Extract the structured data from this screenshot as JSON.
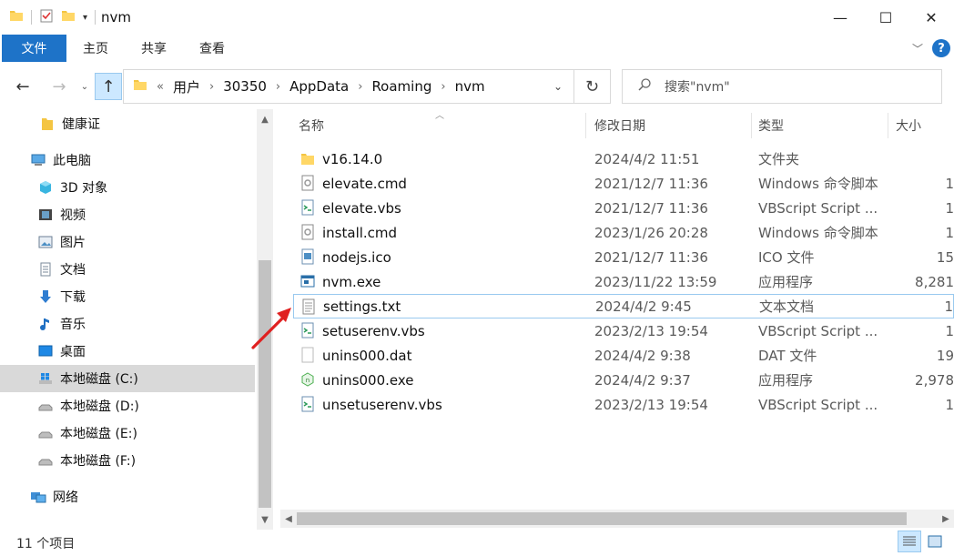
{
  "window": {
    "title": "nvm",
    "minimize": "—",
    "maximize": "☐",
    "close": "✕"
  },
  "ribbon": {
    "file": "文件",
    "home": "主页",
    "share": "共享",
    "view": "查看",
    "help": "?"
  },
  "address": {
    "overflow": "«",
    "crumbs": [
      "用户",
      "30350",
      "AppData",
      "Roaming",
      "nvm"
    ],
    "search_placeholder": "搜索\"nvm\""
  },
  "sidebar": {
    "items": [
      {
        "label": "健康证",
        "icon": "folder-icon"
      },
      {
        "label": "此电脑",
        "icon": "computer-icon"
      },
      {
        "label": "3D 对象",
        "icon": "3d-objects-icon"
      },
      {
        "label": "视频",
        "icon": "video-icon"
      },
      {
        "label": "图片",
        "icon": "pictures-icon"
      },
      {
        "label": "文档",
        "icon": "documents-icon"
      },
      {
        "label": "下载",
        "icon": "download-icon"
      },
      {
        "label": "音乐",
        "icon": "music-icon"
      },
      {
        "label": "桌面",
        "icon": "desktop-icon"
      },
      {
        "label": "本地磁盘 (C:)",
        "icon": "windows-drive-icon",
        "selected": true
      },
      {
        "label": "本地磁盘 (D:)",
        "icon": "drive-icon"
      },
      {
        "label": "本地磁盘 (E:)",
        "icon": "drive-icon"
      },
      {
        "label": "本地磁盘 (F:)",
        "icon": "drive-icon"
      },
      {
        "label": "网络",
        "icon": "network-icon"
      }
    ]
  },
  "columns": {
    "name": "名称",
    "date": "修改日期",
    "type": "类型",
    "size": "大小"
  },
  "files": [
    {
      "name": "v16.14.0",
      "date": "2024/4/2 11:51",
      "type": "文件夹",
      "size": "",
      "icon": "folder-icon"
    },
    {
      "name": "elevate.cmd",
      "date": "2021/12/7 11:36",
      "type": "Windows 命令脚本",
      "size": "1",
      "icon": "cmd-icon"
    },
    {
      "name": "elevate.vbs",
      "date": "2021/12/7 11:36",
      "type": "VBScript Script ...",
      "size": "1",
      "icon": "vbs-icon"
    },
    {
      "name": "install.cmd",
      "date": "2023/1/26 20:28",
      "type": "Windows 命令脚本",
      "size": "1",
      "icon": "cmd-icon"
    },
    {
      "name": "nodejs.ico",
      "date": "2021/12/7 11:36",
      "type": "ICO 文件",
      "size": "15",
      "icon": "image-icon"
    },
    {
      "name": "nvm.exe",
      "date": "2023/11/22 13:59",
      "type": "应用程序",
      "size": "8,281",
      "icon": "exe-icon"
    },
    {
      "name": "settings.txt",
      "date": "2024/4/2 9:45",
      "type": "文本文档",
      "size": "1",
      "icon": "txt-icon",
      "selected": true
    },
    {
      "name": "setuserenv.vbs",
      "date": "2023/2/13 19:54",
      "type": "VBScript Script ...",
      "size": "1",
      "icon": "vbs-icon"
    },
    {
      "name": "unins000.dat",
      "date": "2024/4/2 9:38",
      "type": "DAT 文件",
      "size": "19",
      "icon": "blank-file-icon"
    },
    {
      "name": "unins000.exe",
      "date": "2024/4/2 9:37",
      "type": "应用程序",
      "size": "2,978",
      "icon": "uninstaller-icon"
    },
    {
      "name": "unsetuserenv.vbs",
      "date": "2023/2/13 19:54",
      "type": "VBScript Script ...",
      "size": "1",
      "icon": "vbs-icon"
    }
  ],
  "status": {
    "count": "11 个项目"
  },
  "colors": {
    "accent": "#1e73c8",
    "selection": "#99c9ef",
    "annotation": "#e02020"
  }
}
